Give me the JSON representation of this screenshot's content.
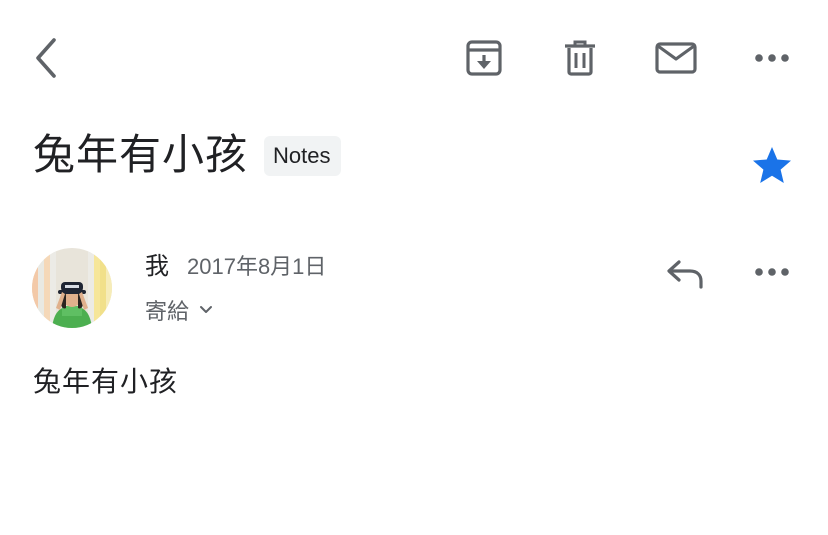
{
  "toolbar": {
    "back_icon": "chevron-left-icon",
    "archive_icon": "archive-icon",
    "delete_icon": "trash-icon",
    "mark_unread_icon": "envelope-icon",
    "more_icon": "more-horizontal-icon"
  },
  "message": {
    "subject": "兔年有小孩",
    "label": "Notes",
    "starred": true,
    "star_color": "#1a73e8",
    "sender": {
      "name": "我",
      "date": "2017年8月1日",
      "recipient_label": "寄給"
    },
    "body": "兔年有小孩"
  },
  "colors": {
    "icon_gray": "#5f6368",
    "text_primary": "#202124",
    "chip_bg": "#f1f3f4"
  }
}
